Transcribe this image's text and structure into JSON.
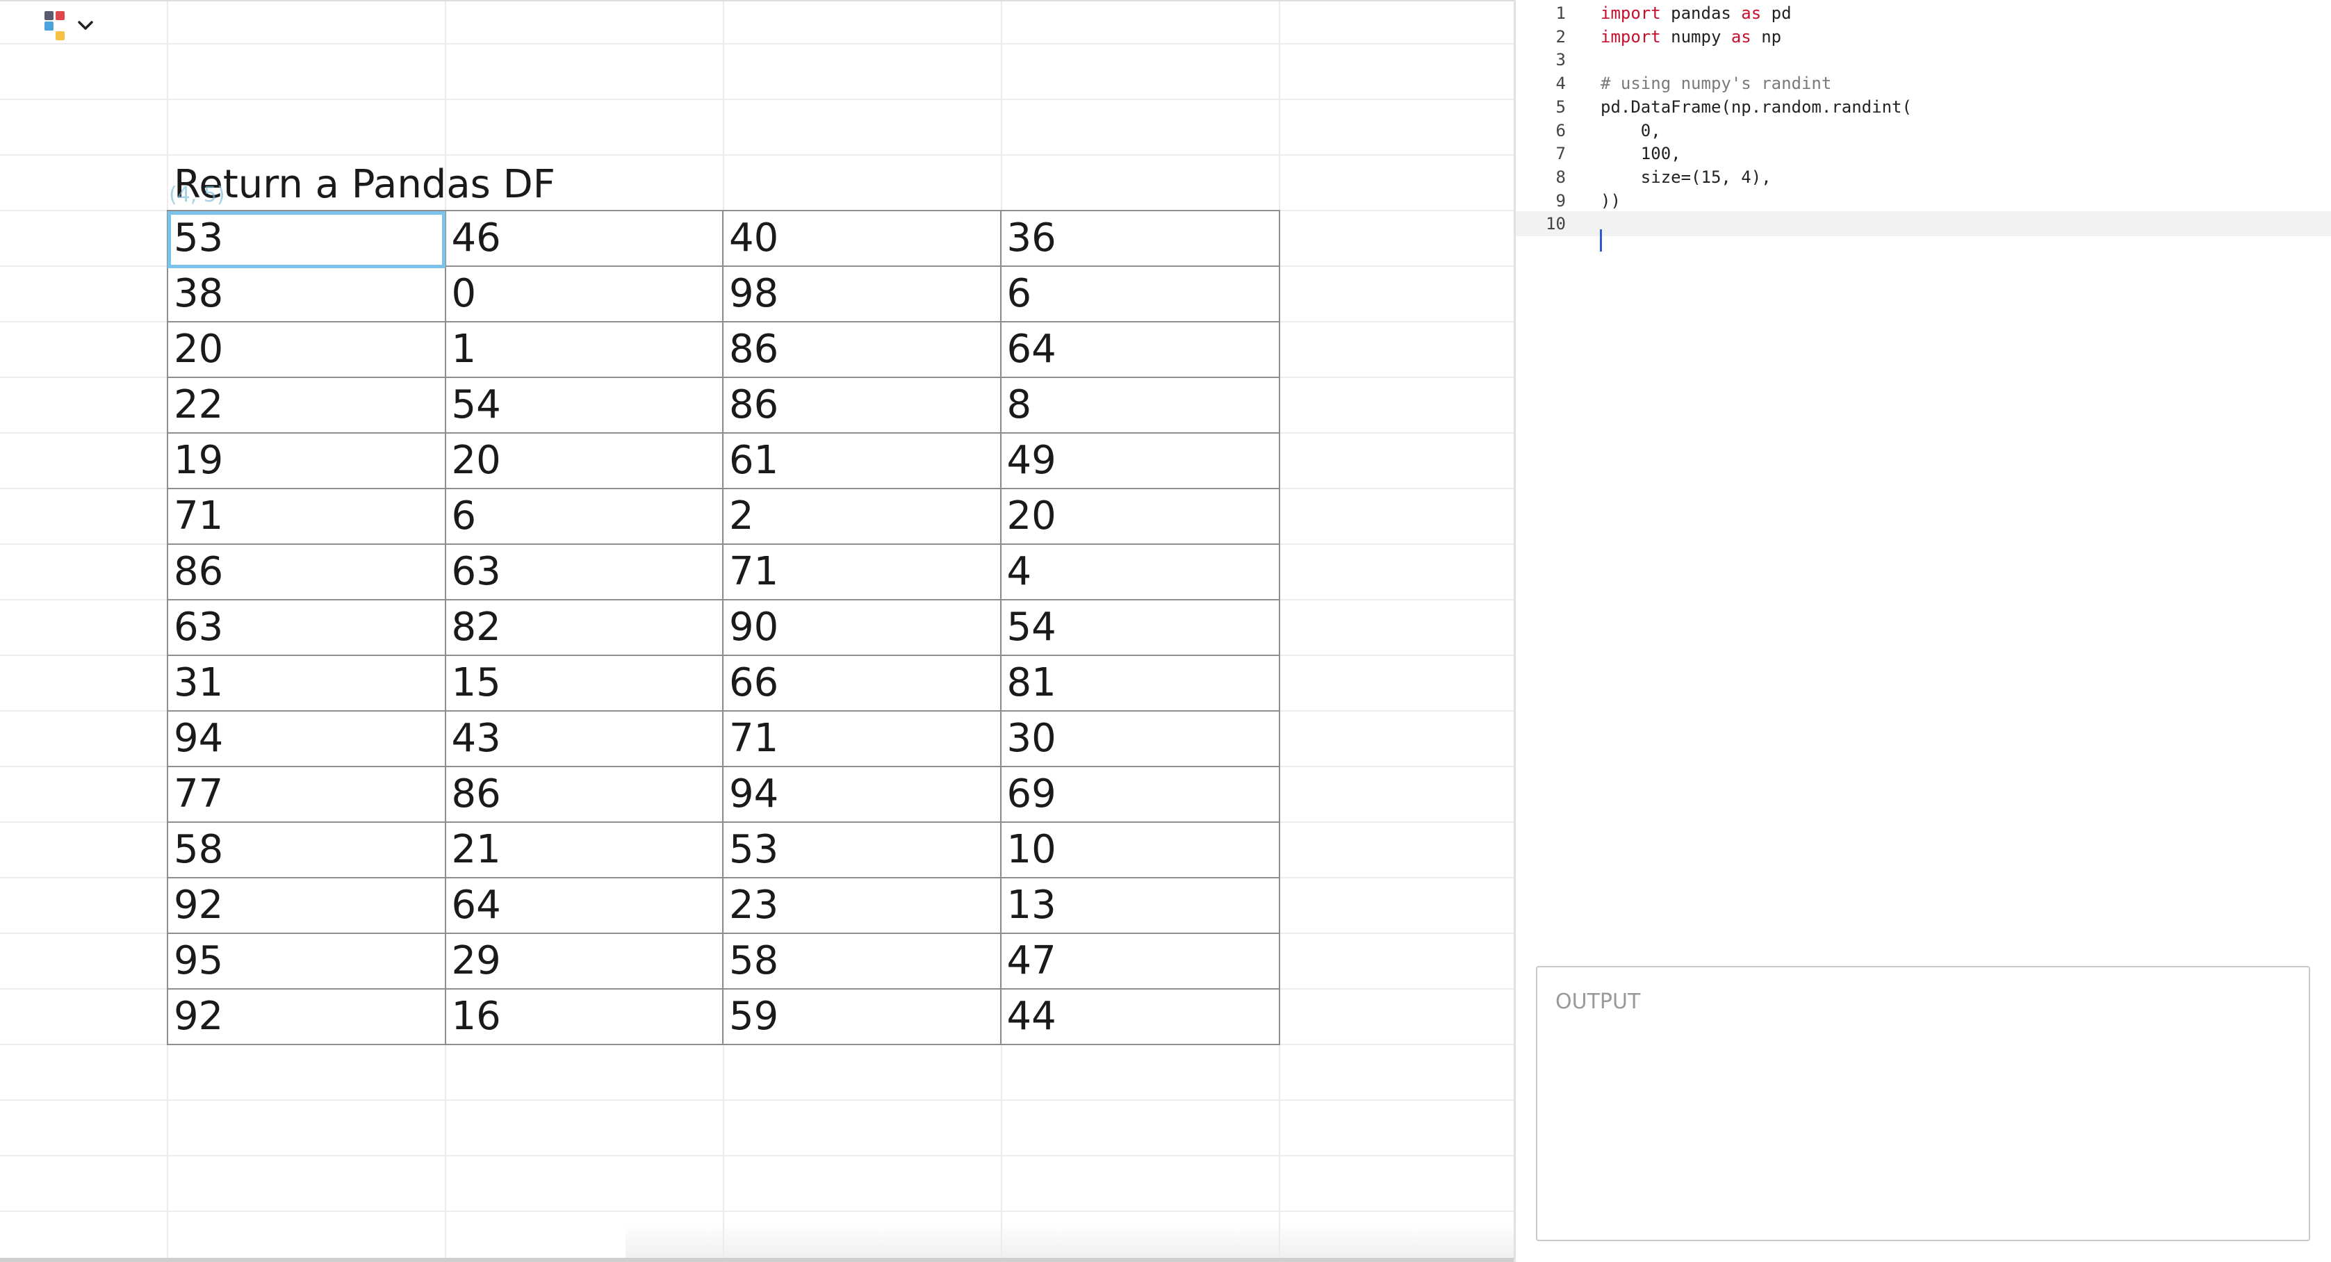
{
  "sheet": {
    "title": "Return a Pandas DF",
    "shape_hint": "(4, 5)",
    "selected_cell": {
      "row": 1,
      "column": 1
    },
    "rows": [
      [
        "53",
        "46",
        "40",
        "36"
      ],
      [
        "38",
        "0",
        "98",
        "6"
      ],
      [
        "20",
        "1",
        "86",
        "64"
      ],
      [
        "22",
        "54",
        "86",
        "8"
      ],
      [
        "19",
        "20",
        "61",
        "49"
      ],
      [
        "71",
        "6",
        "2",
        "20"
      ],
      [
        "86",
        "63",
        "71",
        "4"
      ],
      [
        "63",
        "82",
        "90",
        "54"
      ],
      [
        "31",
        "15",
        "66",
        "81"
      ],
      [
        "94",
        "43",
        "71",
        "30"
      ],
      [
        "77",
        "86",
        "94",
        "69"
      ],
      [
        "58",
        "21",
        "53",
        "10"
      ],
      [
        "92",
        "64",
        "23",
        "13"
      ],
      [
        "95",
        "29",
        "58",
        "47"
      ],
      [
        "92",
        "16",
        "59",
        "44"
      ]
    ]
  },
  "toolbar": {
    "logo_icon": "app-logo-icon",
    "menu_icon": "chevron-down-icon",
    "logo_colors": [
      "#5b5b6e",
      "#e0474c",
      "#4aa3df",
      "#f5c142"
    ]
  },
  "editor": {
    "current_line": 10,
    "lines": [
      {
        "number": "1",
        "tokens": [
          {
            "t": "import",
            "k": "kw"
          },
          {
            "t": " pandas "
          },
          {
            "t": "as",
            "k": "kw"
          },
          {
            "t": " pd"
          }
        ]
      },
      {
        "number": "2",
        "tokens": [
          {
            "t": "import",
            "k": "kw"
          },
          {
            "t": " numpy "
          },
          {
            "t": "as",
            "k": "kw"
          },
          {
            "t": " np"
          }
        ]
      },
      {
        "number": "3",
        "tokens": []
      },
      {
        "number": "4",
        "tokens": [
          {
            "t": "# using numpy's randint",
            "k": "comment"
          }
        ]
      },
      {
        "number": "5",
        "tokens": [
          {
            "t": "pd.DataFrame(np.random.randint("
          }
        ]
      },
      {
        "number": "6",
        "tokens": [
          {
            "t": "    0,"
          }
        ]
      },
      {
        "number": "7",
        "tokens": [
          {
            "t": "    100,"
          }
        ]
      },
      {
        "number": "8",
        "tokens": [
          {
            "t": "    size=(15, 4),"
          }
        ]
      },
      {
        "number": "9",
        "tokens": [
          {
            "t": "))"
          }
        ]
      },
      {
        "number": "10",
        "tokens": []
      }
    ]
  },
  "output": {
    "label": "OUTPUT"
  },
  "colors": {
    "selection": "#79c3ec",
    "keyword": "#c8102e",
    "comment": "#7a7a7a",
    "cursor": "#2c5bd6",
    "grid_border": "#8e8e8e"
  }
}
